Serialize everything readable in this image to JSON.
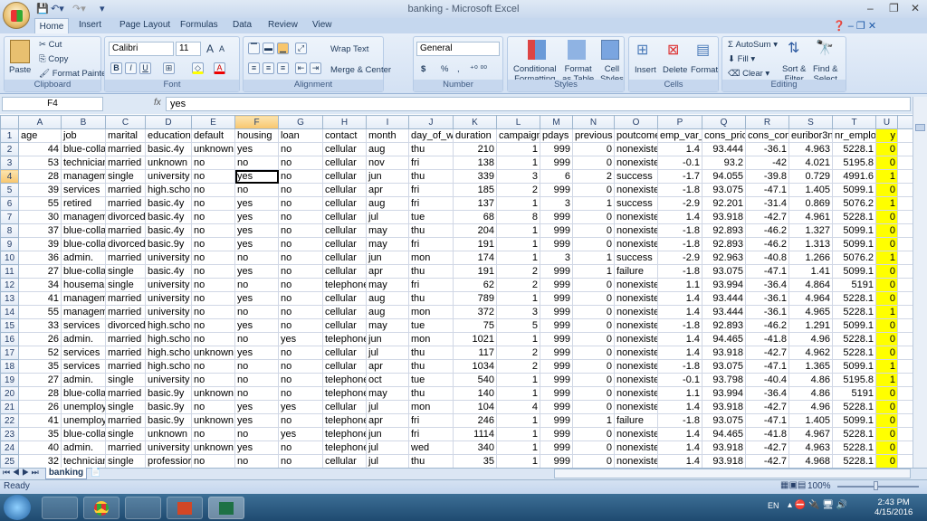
{
  "window": {
    "title": "banking - Microsoft Excel",
    "minimize": "–",
    "restore": "❐",
    "close": "✕"
  },
  "tabs": [
    "Home",
    "Insert",
    "Page Layout",
    "Formulas",
    "Data",
    "Review",
    "View"
  ],
  "ribbon": {
    "clipboard": {
      "label": "Clipboard",
      "paste": "Paste",
      "cut": "Cut",
      "copy": "Copy",
      "format_painter": "Format Painter"
    },
    "font": {
      "label": "Font",
      "name": "Calibri",
      "size": "11",
      "bold": "B",
      "italic": "I",
      "underline": "U",
      "grow": "A",
      "shrink": "A",
      "color": "A"
    },
    "alignment": {
      "label": "Alignment",
      "wrap": "Wrap Text",
      "merge": "Merge & Center"
    },
    "number": {
      "label": "Number",
      "format": "General",
      "currency": "$",
      "percent": "%",
      "comma": ","
    },
    "styles": {
      "label": "Styles",
      "conditional": "Conditional",
      "conditional2": "Formatting",
      "table": "Format",
      "table2": "as Table",
      "cell": "Cell",
      "cell2": "Styles"
    },
    "cells": {
      "label": "Cells",
      "insert": "Insert",
      "delete": "Delete",
      "format": "Format"
    },
    "editing": {
      "label": "Editing",
      "autosum": "AutoSum",
      "fill": "Fill",
      "clear": "Clear",
      "sort": "Sort &",
      "sort2": "Filter",
      "find": "Find &",
      "find2": "Select"
    }
  },
  "formula_bar": {
    "name_box": "F4",
    "fx": "fx",
    "value": "yes"
  },
  "columns": [
    "A",
    "B",
    "C",
    "D",
    "E",
    "F",
    "G",
    "H",
    "I",
    "J",
    "K",
    "L",
    "M",
    "N",
    "O",
    "P",
    "Q",
    "R",
    "S",
    "T",
    "U"
  ],
  "selected_cell": {
    "col": "F",
    "row": 4
  },
  "highlight_color": "#ffff00",
  "headers": [
    "age",
    "job",
    "marital",
    "education",
    "default",
    "housing",
    "loan",
    "contact",
    "month",
    "day_of_w",
    "duration",
    "campaign",
    "pdays",
    "previous",
    "poutcome",
    "emp_var_",
    "cons_pric",
    "cons_conf",
    "euribor3n",
    "nr_emplo",
    "y"
  ],
  "rows": [
    [
      "44",
      "blue-colla",
      "married",
      "basic.4y",
      "unknown",
      "yes",
      "no",
      "cellular",
      "aug",
      "thu",
      "210",
      "1",
      "999",
      "0",
      "nonexiste",
      "1.4",
      "93.444",
      "-36.1",
      "4.963",
      "5228.1",
      "0"
    ],
    [
      "53",
      "technician",
      "married",
      "unknown",
      "no",
      "no",
      "no",
      "cellular",
      "nov",
      "fri",
      "138",
      "1",
      "999",
      "0",
      "nonexiste",
      "-0.1",
      "93.2",
      "-42",
      "4.021",
      "5195.8",
      "0"
    ],
    [
      "28",
      "managem",
      "single",
      "university",
      "no",
      "yes",
      "no",
      "cellular",
      "jun",
      "thu",
      "339",
      "3",
      "6",
      "2",
      "success",
      "-1.7",
      "94.055",
      "-39.8",
      "0.729",
      "4991.6",
      "1"
    ],
    [
      "39",
      "services",
      "married",
      "high.scho",
      "no",
      "no",
      "no",
      "cellular",
      "apr",
      "fri",
      "185",
      "2",
      "999",
      "0",
      "nonexiste",
      "-1.8",
      "93.075",
      "-47.1",
      "1.405",
      "5099.1",
      "0"
    ],
    [
      "55",
      "retired",
      "married",
      "basic.4y",
      "no",
      "yes",
      "no",
      "cellular",
      "aug",
      "fri",
      "137",
      "1",
      "3",
      "1",
      "success",
      "-2.9",
      "92.201",
      "-31.4",
      "0.869",
      "5076.2",
      "1"
    ],
    [
      "30",
      "managem",
      "divorced",
      "basic.4y",
      "no",
      "yes",
      "no",
      "cellular",
      "jul",
      "tue",
      "68",
      "8",
      "999",
      "0",
      "nonexiste",
      "1.4",
      "93.918",
      "-42.7",
      "4.961",
      "5228.1",
      "0"
    ],
    [
      "37",
      "blue-colla",
      "married",
      "basic.4y",
      "no",
      "yes",
      "no",
      "cellular",
      "may",
      "thu",
      "204",
      "1",
      "999",
      "0",
      "nonexiste",
      "-1.8",
      "92.893",
      "-46.2",
      "1.327",
      "5099.1",
      "0"
    ],
    [
      "39",
      "blue-colla",
      "divorced",
      "basic.9y",
      "no",
      "yes",
      "no",
      "cellular",
      "may",
      "fri",
      "191",
      "1",
      "999",
      "0",
      "nonexiste",
      "-1.8",
      "92.893",
      "-46.2",
      "1.313",
      "5099.1",
      "0"
    ],
    [
      "36",
      "admin.",
      "married",
      "university",
      "no",
      "no",
      "no",
      "cellular",
      "jun",
      "mon",
      "174",
      "1",
      "3",
      "1",
      "success",
      "-2.9",
      "92.963",
      "-40.8",
      "1.266",
      "5076.2",
      "1"
    ],
    [
      "27",
      "blue-colla",
      "single",
      "basic.4y",
      "no",
      "yes",
      "no",
      "cellular",
      "apr",
      "thu",
      "191",
      "2",
      "999",
      "1",
      "failure",
      "-1.8",
      "93.075",
      "-47.1",
      "1.41",
      "5099.1",
      "0"
    ],
    [
      "34",
      "housemai",
      "single",
      "university",
      "no",
      "no",
      "no",
      "telephone",
      "may",
      "fri",
      "62",
      "2",
      "999",
      "0",
      "nonexiste",
      "1.1",
      "93.994",
      "-36.4",
      "4.864",
      "5191",
      "0"
    ],
    [
      "41",
      "managem",
      "married",
      "university",
      "no",
      "yes",
      "no",
      "cellular",
      "aug",
      "thu",
      "789",
      "1",
      "999",
      "0",
      "nonexiste",
      "1.4",
      "93.444",
      "-36.1",
      "4.964",
      "5228.1",
      "0"
    ],
    [
      "55",
      "managem",
      "married",
      "university",
      "no",
      "no",
      "no",
      "cellular",
      "aug",
      "mon",
      "372",
      "3",
      "999",
      "0",
      "nonexiste",
      "1.4",
      "93.444",
      "-36.1",
      "4.965",
      "5228.1",
      "1"
    ],
    [
      "33",
      "services",
      "divorced",
      "high.scho",
      "no",
      "yes",
      "no",
      "cellular",
      "may",
      "tue",
      "75",
      "5",
      "999",
      "0",
      "nonexiste",
      "-1.8",
      "92.893",
      "-46.2",
      "1.291",
      "5099.1",
      "0"
    ],
    [
      "26",
      "admin.",
      "married",
      "high.scho",
      "no",
      "no",
      "yes",
      "telephone",
      "jun",
      "mon",
      "1021",
      "1",
      "999",
      "0",
      "nonexiste",
      "1.4",
      "94.465",
      "-41.8",
      "4.96",
      "5228.1",
      "0"
    ],
    [
      "52",
      "services",
      "married",
      "high.scho",
      "unknown",
      "yes",
      "no",
      "cellular",
      "jul",
      "thu",
      "117",
      "2",
      "999",
      "0",
      "nonexiste",
      "1.4",
      "93.918",
      "-42.7",
      "4.962",
      "5228.1",
      "0"
    ],
    [
      "35",
      "services",
      "married",
      "high.scho",
      "no",
      "no",
      "no",
      "cellular",
      "apr",
      "thu",
      "1034",
      "2",
      "999",
      "0",
      "nonexiste",
      "-1.8",
      "93.075",
      "-47.1",
      "1.365",
      "5099.1",
      "1"
    ],
    [
      "27",
      "admin.",
      "single",
      "university",
      "no",
      "no",
      "no",
      "telephone",
      "oct",
      "tue",
      "540",
      "1",
      "999",
      "0",
      "nonexiste",
      "-0.1",
      "93.798",
      "-40.4",
      "4.86",
      "5195.8",
      "1"
    ],
    [
      "28",
      "blue-colla",
      "married",
      "basic.9y",
      "unknown",
      "no",
      "no",
      "telephone",
      "may",
      "thu",
      "140",
      "1",
      "999",
      "0",
      "nonexiste",
      "1.1",
      "93.994",
      "-36.4",
      "4.86",
      "5191",
      "0"
    ],
    [
      "26",
      "unemploy",
      "single",
      "basic.9y",
      "no",
      "yes",
      "yes",
      "cellular",
      "jul",
      "mon",
      "104",
      "4",
      "999",
      "0",
      "nonexiste",
      "1.4",
      "93.918",
      "-42.7",
      "4.96",
      "5228.1",
      "0"
    ],
    [
      "41",
      "unemploy",
      "married",
      "basic.9y",
      "unknown",
      "yes",
      "no",
      "telephone",
      "apr",
      "fri",
      "246",
      "1",
      "999",
      "1",
      "failure",
      "-1.8",
      "93.075",
      "-47.1",
      "1.405",
      "5099.1",
      "0"
    ],
    [
      "35",
      "blue-colla",
      "single",
      "unknown",
      "no",
      "no",
      "yes",
      "telephone",
      "jun",
      "fri",
      "1114",
      "1",
      "999",
      "0",
      "nonexiste",
      "1.4",
      "94.465",
      "-41.8",
      "4.967",
      "5228.1",
      "0"
    ],
    [
      "40",
      "admin.",
      "married",
      "university",
      "unknown",
      "yes",
      "no",
      "telephone",
      "jul",
      "wed",
      "340",
      "1",
      "999",
      "0",
      "nonexiste",
      "1.4",
      "93.918",
      "-42.7",
      "4.963",
      "5228.1",
      "0"
    ],
    [
      "32",
      "technician",
      "single",
      "professior",
      "no",
      "no",
      "no",
      "cellular",
      "jul",
      "thu",
      "35",
      "1",
      "999",
      "0",
      "nonexiste",
      "1.4",
      "93.918",
      "-42.7",
      "4.968",
      "5228.1",
      "0"
    ]
  ],
  "sheet_tabs": [
    "banking"
  ],
  "status": {
    "text": "Ready",
    "zoom": "100%"
  },
  "taskbar": {
    "apps": [
      "file-explorer",
      "chrome",
      "task-manager",
      "powerpoint",
      "excel"
    ],
    "lang": "EN",
    "time": "2:43 PM",
    "date": "4/15/2016"
  }
}
